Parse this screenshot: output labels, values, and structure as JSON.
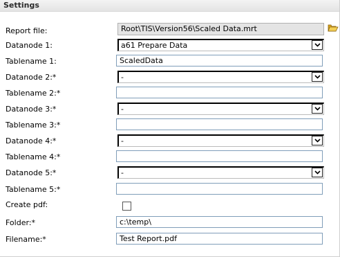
{
  "header": {
    "title": "Settings"
  },
  "report_file": {
    "label": "Report file:",
    "value": "Root\\TIS\\Version56\\Scaled Data.mrt",
    "browse_icon": "folder-open-icon"
  },
  "datanodes": [
    {
      "label": "Datanode 1:",
      "value": "a61 Prepare Data"
    },
    {
      "label": "Datanode 2:*",
      "value": "-"
    },
    {
      "label": "Datanode 3:*",
      "value": "-"
    },
    {
      "label": "Datanode 4:*",
      "value": "-"
    },
    {
      "label": "Datanode 5:*",
      "value": "-"
    }
  ],
  "tablenames": [
    {
      "label": "Tablename 1:",
      "value": "ScaledData"
    },
    {
      "label": "Tablename 2:*",
      "value": ""
    },
    {
      "label": "Tablename 3:*",
      "value": ""
    },
    {
      "label": "Tablename 4:*",
      "value": ""
    },
    {
      "label": "Tablename 5:*",
      "value": ""
    }
  ],
  "create_pdf": {
    "label": "Create pdf:",
    "checked": false
  },
  "folder": {
    "label": "Folder:*",
    "value": "c:\\temp\\"
  },
  "filename": {
    "label": "Filename:*",
    "value": "Test Report.pdf"
  },
  "colors": {
    "header_bg": "#e8e8e8",
    "readonly_bg": "#e4e4e4",
    "input_border": "#7f9db9",
    "folder_yellow": "#e8b830"
  }
}
